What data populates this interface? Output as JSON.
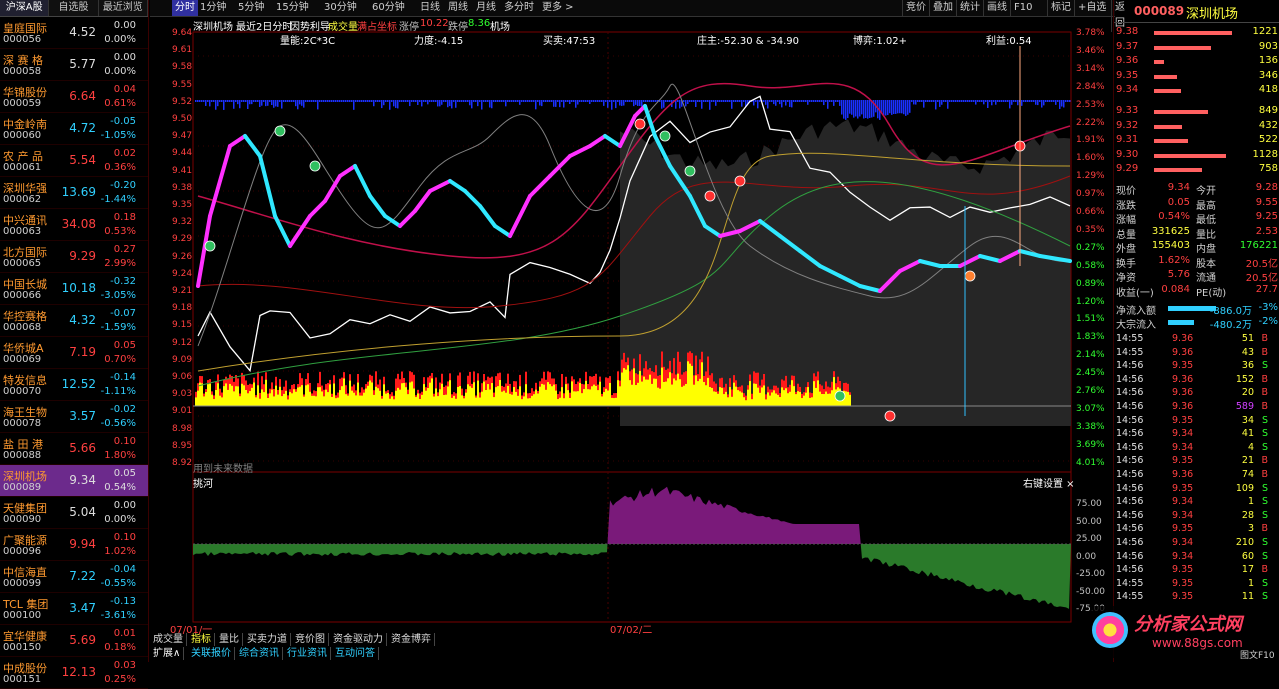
{
  "left_panel": {
    "tabs": [
      "沪深A股",
      "自选股",
      "最近浏览"
    ],
    "stocks": [
      {
        "name": "皇庭国际",
        "code": "000056",
        "price": "4.52",
        "change": "0.00",
        "pct": "0.00%",
        "dir": "eq"
      },
      {
        "name": "深 赛 格",
        "code": "000058",
        "price": "5.77",
        "change": "0.00",
        "pct": "0.00%",
        "dir": "eq"
      },
      {
        "name": "华锦股份",
        "code": "000059",
        "price": "6.64",
        "change": "0.04",
        "pct": "0.61%",
        "dir": "up"
      },
      {
        "name": "中金岭南",
        "code": "000060",
        "price": "4.72",
        "change": "-0.05",
        "pct": "-1.05%",
        "dir": "dn"
      },
      {
        "name": "农 产 品",
        "code": "000061",
        "price": "5.54",
        "change": "0.02",
        "pct": "0.36%",
        "dir": "up"
      },
      {
        "name": "深圳华强",
        "code": "000062",
        "price": "13.69",
        "change": "-0.20",
        "pct": "-1.44%",
        "dir": "dn"
      },
      {
        "name": "中兴通讯",
        "code": "000063",
        "price": "34.08",
        "change": "0.18",
        "pct": "0.53%",
        "dir": "up"
      },
      {
        "name": "北方国际",
        "code": "000065",
        "price": "9.29",
        "change": "0.27",
        "pct": "2.99%",
        "dir": "up"
      },
      {
        "name": "中国长城",
        "code": "000066",
        "price": "10.18",
        "change": "-0.32",
        "pct": "-3.05%",
        "dir": "dn"
      },
      {
        "name": "华控赛格",
        "code": "000068",
        "price": "4.32",
        "change": "-0.07",
        "pct": "-1.59%",
        "dir": "dn"
      },
      {
        "name": "华侨城A",
        "code": "000069",
        "price": "7.19",
        "change": "0.05",
        "pct": "0.70%",
        "dir": "up"
      },
      {
        "name": "特发信息",
        "code": "000070",
        "price": "12.52",
        "change": "-0.14",
        "pct": "-1.11%",
        "dir": "dn"
      },
      {
        "name": "海王生物",
        "code": "000078",
        "price": "3.57",
        "change": "-0.02",
        "pct": "-0.56%",
        "dir": "dn"
      },
      {
        "name": "盐 田 港",
        "code": "000088",
        "price": "5.66",
        "change": "0.10",
        "pct": "1.80%",
        "dir": "up"
      },
      {
        "name": "深圳机场",
        "code": "000089",
        "price": "9.34",
        "change": "0.05",
        "pct": "0.54%",
        "dir": "up",
        "selected": true
      },
      {
        "name": "天健集团",
        "code": "000090",
        "price": "5.04",
        "change": "0.00",
        "pct": "0.00%",
        "dir": "eq"
      },
      {
        "name": "广聚能源",
        "code": "000096",
        "price": "9.94",
        "change": "0.10",
        "pct": "1.02%",
        "dir": "up"
      },
      {
        "name": "中信海直",
        "code": "000099",
        "price": "7.22",
        "change": "-0.04",
        "pct": "-0.55%",
        "dir": "dn"
      },
      {
        "name": "TCL 集团",
        "code": "000100",
        "price": "3.47",
        "change": "-0.13",
        "pct": "-3.61%",
        "dir": "dn"
      },
      {
        "name": "宜华健康",
        "code": "000150",
        "price": "5.69",
        "change": "0.01",
        "pct": "0.18%",
        "dir": "up"
      },
      {
        "name": "中成股份",
        "code": "000151",
        "price": "12.13",
        "change": "0.03",
        "pct": "0.25%",
        "dir": "up"
      }
    ]
  },
  "toolbar": {
    "left": [
      "分时",
      "1分钟",
      "5分钟",
      "15分钟",
      "30分钟",
      "60分钟",
      "日线",
      "周线",
      "月线",
      "多分时",
      "更多 >"
    ],
    "right": [
      "竞价",
      "叠加",
      "统计",
      "画线",
      "F10",
      "标记",
      "+自选",
      "返回"
    ]
  },
  "chart": {
    "info_line": {
      "name": "深圳机场",
      "period": "最近2日分时",
      "indicator": "因势利导",
      "vol": "成交量",
      "coord": "满占坐标",
      "limit_up_label": "涨停",
      "limit_up": "10.22",
      "limit_down_label": "跌停",
      "limit_down": "8.36",
      "tag": "机场"
    },
    "sub_labels": [
      "量能:2C*3C",
      "力度:-4.15",
      "买卖:47:53",
      "庄主:-52.30 & -34.90",
      "博弈:1.02+",
      "利益:0.54"
    ],
    "price_ticks": [
      "9.64",
      "9.61",
      "9.58",
      "9.55",
      "9.52",
      "9.50",
      "9.47",
      "9.44",
      "9.41",
      "9.38",
      "9.35",
      "9.32",
      "9.29",
      "9.26",
      "9.24",
      "9.21",
      "9.18",
      "9.15",
      "9.12",
      "9.09",
      "9.06",
      "9.03",
      "9.01",
      "8.98",
      "8.95",
      "8.92"
    ],
    "pct_ticks": [
      "3.78%",
      "3.46%",
      "3.14%",
      "2.84%",
      "2.53%",
      "2.22%",
      "1.91%",
      "1.60%",
      "1.29%",
      "0.97%",
      "0.66%",
      "0.35%",
      "0.27%",
      "0.58%",
      "0.89%",
      "1.20%",
      "1.51%",
      "1.83%",
      "2.14%",
      "2.45%",
      "2.76%",
      "3.07%",
      "3.38%",
      "3.69%",
      "4.01%"
    ],
    "no_data": "用到未来数据",
    "lower_title": "挑河",
    "lower_right": "右键设置 ×",
    "lower_ticks": [
      "75.00",
      "50.00",
      "25.00",
      "0.00",
      "-25.00",
      "-50.00",
      "-75.00"
    ],
    "dates": [
      "07/01/一",
      "07/02/二"
    ],
    "bottom_tabs": [
      "成交量",
      "指标",
      "量比",
      "买卖力道",
      "竞价图",
      "资金驱动力",
      "资金博弈"
    ],
    "status_tabs": [
      "扩展∧",
      "关联报价",
      "综合资讯",
      "行业资讯",
      "互动问答"
    ]
  },
  "right_panel": {
    "code": "000089",
    "name": "深圳机场",
    "asks": [
      {
        "p": "9.38",
        "v": "1221",
        "w": 0.95
      },
      {
        "p": "9.37",
        "v": "903",
        "w": 0.7
      },
      {
        "p": "9.36",
        "v": "136",
        "w": 0.12
      },
      {
        "p": "9.35",
        "v": "346",
        "w": 0.28
      },
      {
        "p": "9.34",
        "v": "418",
        "w": 0.33
      }
    ],
    "bids": [
      {
        "p": "9.33",
        "v": "849",
        "w": 0.66
      },
      {
        "p": "9.32",
        "v": "432",
        "w": 0.34
      },
      {
        "p": "9.31",
        "v": "522",
        "w": 0.41
      },
      {
        "p": "9.30",
        "v": "1128",
        "w": 0.88
      },
      {
        "p": "9.29",
        "v": "758",
        "w": 0.59
      }
    ],
    "stats": [
      [
        "现价",
        "9.34",
        "今开",
        "9.28"
      ],
      [
        "涨跌",
        "0.05",
        "最高",
        "9.55"
      ],
      [
        "涨幅",
        "0.54%",
        "最低",
        "9.25"
      ],
      [
        "总量",
        "331625",
        "量比",
        "2.53"
      ],
      [
        "外盘",
        "155403",
        "内盘",
        "176221"
      ],
      [
        "换手",
        "1.62%",
        "股本",
        "20.5亿"
      ],
      [
        "净资",
        "5.76",
        "流通",
        "20.5亿"
      ],
      [
        "收益(一)",
        "0.084",
        "PE(动)",
        "27.7"
      ]
    ],
    "flows": [
      {
        "label": "净流入额",
        "value": "-886.0万",
        "pct": "-3%"
      },
      {
        "label": "大宗流入",
        "value": "-480.2万",
        "pct": "-2%"
      }
    ],
    "ticks": [
      [
        "14:55",
        "9.36",
        "51",
        "B"
      ],
      [
        "14:55",
        "9.36",
        "43",
        "B"
      ],
      [
        "14:56",
        "9.35",
        "36",
        "S"
      ],
      [
        "14:56",
        "9.36",
        "152",
        "B"
      ],
      [
        "14:56",
        "9.36",
        "20",
        "B"
      ],
      [
        "14:56",
        "9.36",
        "589",
        "B"
      ],
      [
        "14:56",
        "9.35",
        "34",
        "S"
      ],
      [
        "14:56",
        "9.34",
        "41",
        "S"
      ],
      [
        "14:56",
        "9.34",
        "4",
        "S"
      ],
      [
        "14:56",
        "9.35",
        "21",
        "B"
      ],
      [
        "14:56",
        "9.36",
        "74",
        "B"
      ],
      [
        "14:56",
        "9.35",
        "109",
        "S"
      ],
      [
        "14:56",
        "9.34",
        "1",
        "S"
      ],
      [
        "14:56",
        "9.34",
        "28",
        "S"
      ],
      [
        "14:56",
        "9.35",
        "3",
        "B"
      ],
      [
        "14:56",
        "9.34",
        "210",
        "S"
      ],
      [
        "14:56",
        "9.34",
        "60",
        "S"
      ],
      [
        "14:56",
        "9.35",
        "17",
        "B"
      ],
      [
        "14:55",
        "9.35",
        "1",
        "S"
      ],
      [
        "14:55",
        "9.35",
        "11",
        "S"
      ]
    ],
    "watermark": "分析家公式网",
    "watermark_url": "www.88gs.com",
    "bottom": "图文F10"
  }
}
